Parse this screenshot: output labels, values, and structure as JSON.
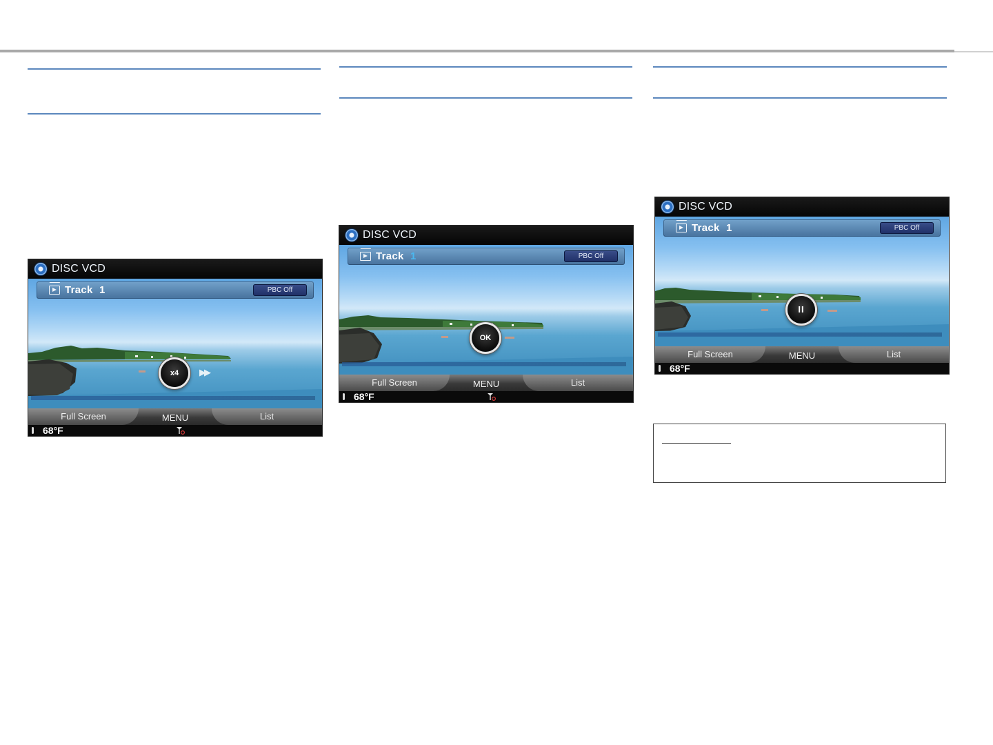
{
  "screens": [
    {
      "title": "DISC VCD",
      "track_label": "Track",
      "track_number": "1",
      "pbc_label": "PBC Off",
      "status_indicator": "x4",
      "menu": {
        "left": "Full Screen",
        "center": "MENU",
        "right": "List"
      },
      "temperature": "68°F"
    },
    {
      "title": "DISC VCD",
      "track_label": "Track",
      "track_number": "1",
      "pbc_label": "PBC Off",
      "status_indicator": "OK",
      "menu": {
        "left": "Full Screen",
        "center": "MENU",
        "right": "List"
      },
      "temperature": "68°F"
    },
    {
      "title": "DISC VCD",
      "track_label": "Track",
      "track_number": "1",
      "pbc_label": "PBC Off",
      "status_indicator": "II",
      "menu": {
        "left": "Full Screen",
        "center": "MENU",
        "right": "List"
      },
      "temperature": "68°F"
    }
  ],
  "icons": {
    "disc": "disc-icon",
    "film": "film-icon",
    "thermometer": "thermometer-icon",
    "signal": "signal-icon",
    "fast_forward": "fast-forward-icon",
    "pause": "pause-icon"
  },
  "colors": {
    "rule_blue": "#5b87bd",
    "top_rule_gray": "#a9a9a9",
    "pbc_navy": "#1f2f66",
    "signal_red": "#d93a3a"
  }
}
